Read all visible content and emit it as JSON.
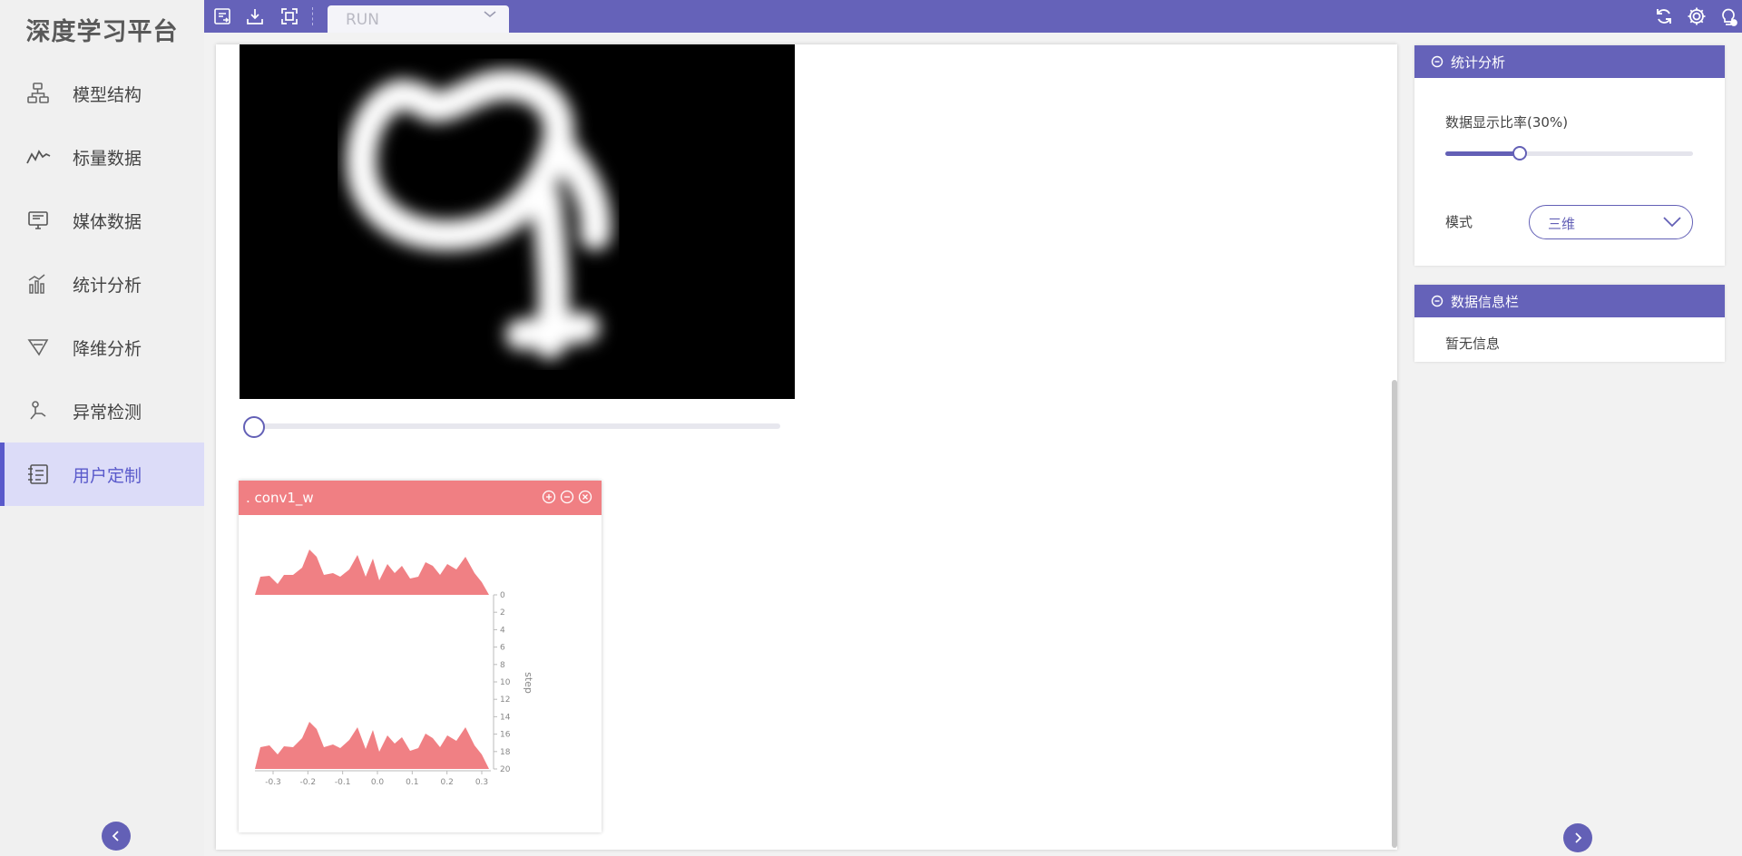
{
  "brand": {
    "title": "深度学习平台"
  },
  "nav": {
    "items": [
      {
        "label": "模型结构",
        "icon": "model-structure-icon"
      },
      {
        "label": "标量数据",
        "icon": "scalar-line-icon"
      },
      {
        "label": "媒体数据",
        "icon": "media-monitor-icon"
      },
      {
        "label": "统计分析",
        "icon": "statistics-bars-icon"
      },
      {
        "label": "降维分析",
        "icon": "funnel-icon"
      },
      {
        "label": "异常检测",
        "icon": "anomaly-icon"
      },
      {
        "label": "用户定制",
        "icon": "custom-panel-icon"
      }
    ],
    "active_index": 6
  },
  "toolbar": {
    "run_select_value": "RUN",
    "accent": "#6562b9"
  },
  "media": {
    "slider_value": 0
  },
  "histogram_card": {
    "title": ". conv1_w",
    "header_color": "#f07f83",
    "x_ticks": [
      "-0.3",
      "-0.2",
      "-0.1",
      "0.0",
      "0.1",
      "0.2",
      "0.3"
    ],
    "y_ticks": [
      "0",
      "2",
      "4",
      "6",
      "8",
      "10",
      "12",
      "14",
      "16",
      "18",
      "20"
    ],
    "y_axis_label": "step"
  },
  "stats_panel": {
    "title": "统计分析",
    "rate_label": "数据显示比率(30%)",
    "rate_value": 0.3,
    "mode_label": "模式",
    "mode_value": "三维"
  },
  "info_panel": {
    "title": "数据信息栏",
    "text": "暂无信息"
  }
}
